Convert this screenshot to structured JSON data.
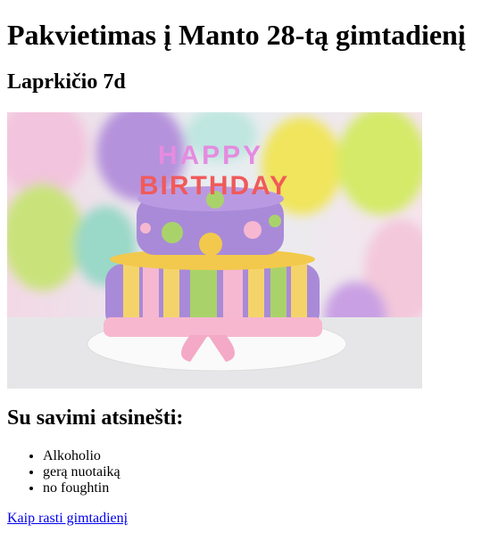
{
  "title": "Pakvietimas į Manto 28-tą gimtadienį",
  "date": "Laprkičio 7d",
  "image": {
    "alt": "Birthday cake",
    "cake_text": "HAPPY BIRTHDAY"
  },
  "bring_heading": "Su savimi atsinešti:",
  "bring_items": [
    "Alkoholio",
    "gerą nuotaiką",
    "no foughtin"
  ],
  "directions_link": "Kaip rasti gimtadienį"
}
